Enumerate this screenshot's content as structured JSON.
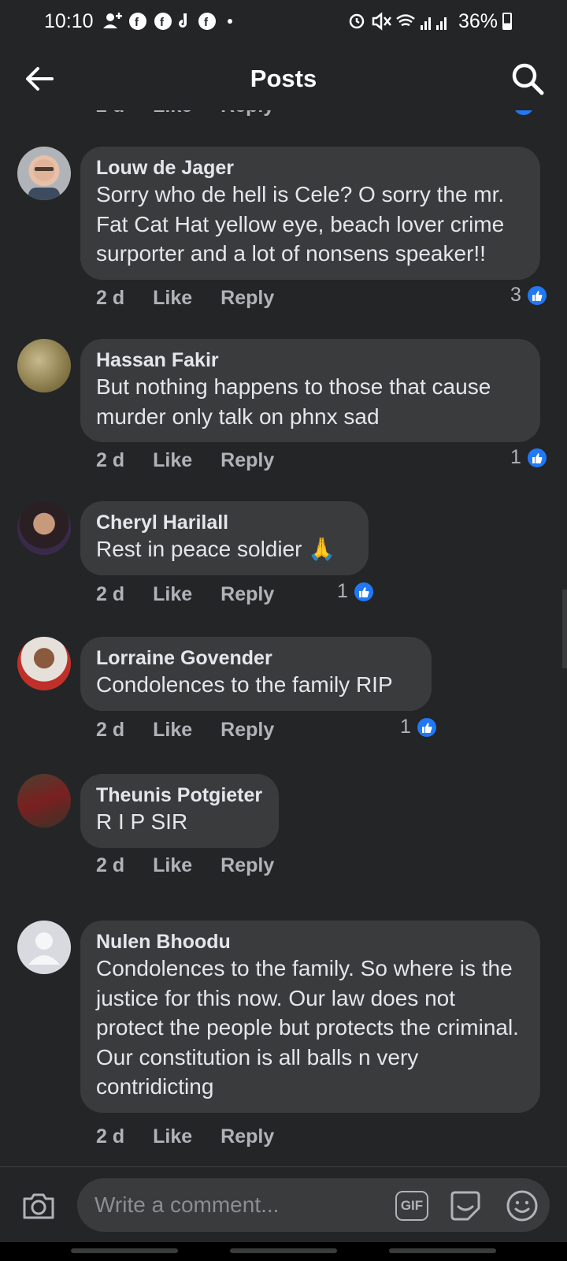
{
  "status_bar": {
    "time": "10:10",
    "battery": "36%",
    "left_icons": [
      "person-add-icon",
      "facebook-icon",
      "facebook-icon",
      "tiktok-icon",
      "facebook-icon",
      "dot-icon"
    ],
    "right_icons": [
      "alarm-icon",
      "mute-icon",
      "wifi-icon",
      "signal-icon",
      "signal-icon",
      "battery-icon"
    ]
  },
  "header": {
    "title": "Posts",
    "back_icon": "arrow-left-icon",
    "search_icon": "search-icon"
  },
  "comments": [
    {
      "author": "Louw de Jager",
      "text": "Sorry who de hell is Cele? O sorry the mr. Fat Cat Hat yellow eye, beach lover crime surporter and a lot of nonsens speaker!!",
      "time": "2 d",
      "like_label": "Like",
      "reply_label": "Reply",
      "reactions": "3"
    },
    {
      "author": "Hassan Fakir",
      "text": "But nothing happens to those that cause murder only talk on phnx sad",
      "time": "2 d",
      "like_label": "Like",
      "reply_label": "Reply",
      "reactions": "1"
    },
    {
      "author": "Cheryl Harilall",
      "text": "Rest in peace soldier 🙏",
      "time": "2 d",
      "like_label": "Like",
      "reply_label": "Reply",
      "reactions": "1"
    },
    {
      "author": "Lorraine Govender",
      "text": "Condolences to the family RIP",
      "time": "2 d",
      "like_label": "Like",
      "reply_label": "Reply",
      "reactions": "1"
    },
    {
      "author": "Theunis Potgieter",
      "text": "R I P SIR",
      "time": "2 d",
      "like_label": "Like",
      "reply_label": "Reply",
      "reactions": ""
    },
    {
      "author": "Nulen Bhoodu",
      "text": "Condolences to the family. So where is the justice for this now. Our law does not protect the people but protects the criminal. Our constitution is all balls n very contridicting",
      "time": "2 d",
      "like_label": "Like",
      "reply_label": "Reply",
      "reactions": ""
    }
  ],
  "composer": {
    "placeholder": "Write a comment...",
    "gif_label": "GIF",
    "camera_icon": "camera-icon",
    "sticker_icon": "sticker-icon",
    "emoji_icon": "emoji-icon"
  },
  "colors": {
    "background": "#242526",
    "bubble": "#3a3b3c",
    "text": "#e4e6eb",
    "secondary_text": "#b0b3b8",
    "like_blue": "#2078f4"
  }
}
